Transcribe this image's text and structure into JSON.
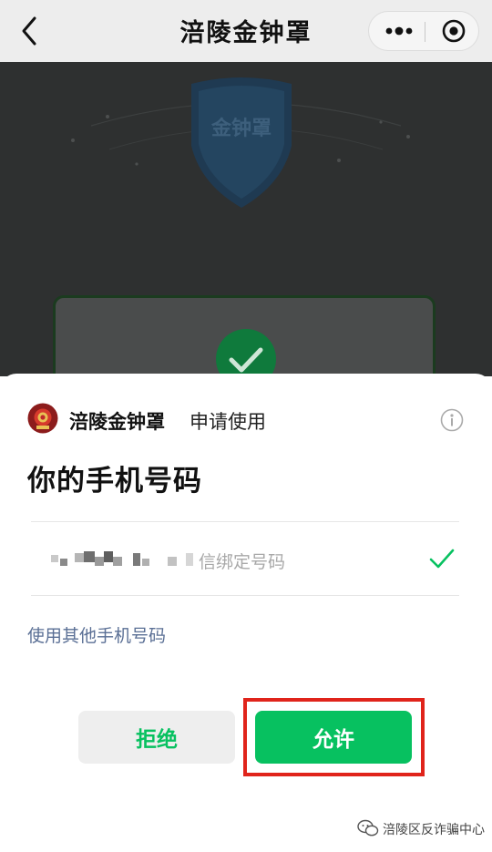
{
  "titlebar": {
    "title": "涪陵金钟罩",
    "back_icon": "back-arrow-icon",
    "more_icon": "more-dots-icon",
    "close_icon": "target-close-icon"
  },
  "background_page": {
    "shield_text": "金钟罩"
  },
  "sheet": {
    "app_name": "涪陵金钟罩",
    "request_text": "申请使用",
    "heading": "你的手机号码",
    "phone_hint": "信绑定号码",
    "other_phone_link": "使用其他手机号码",
    "reject_label": "拒绝",
    "allow_label": "允许"
  },
  "watermark": {
    "text": "涪陵区反诈骗中心"
  },
  "colors": {
    "accent_green": "#07c160",
    "link_blue": "#5a6f95",
    "highlight_red": "#e0241b",
    "overlay_dark": "#2e3030"
  }
}
